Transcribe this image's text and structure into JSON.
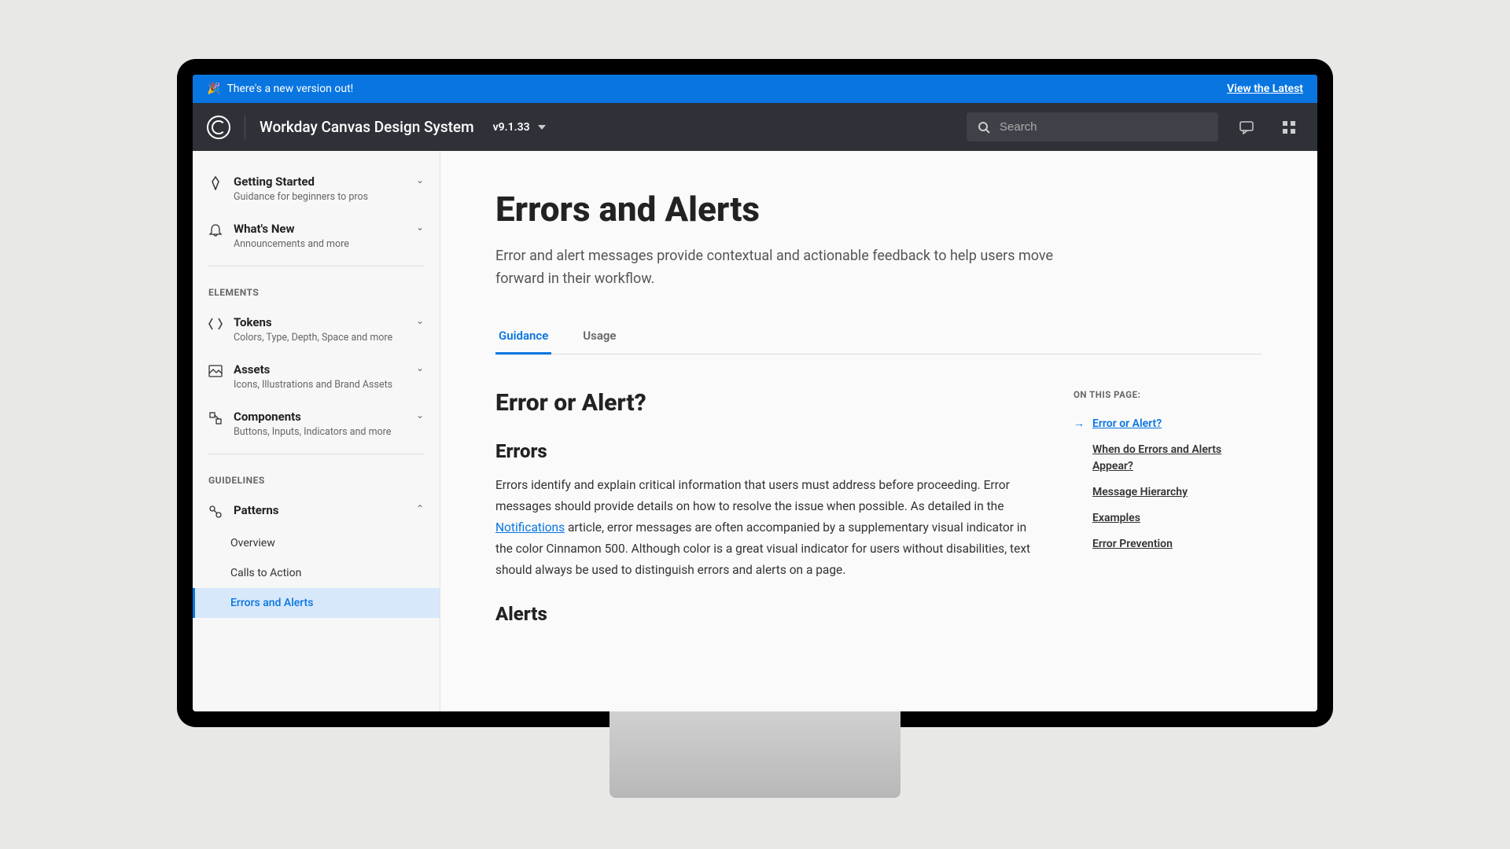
{
  "banner": {
    "emoji": "🎉",
    "text": "There's a new version out!",
    "linkText": "View the Latest"
  },
  "header": {
    "brand": "Workday Canvas Design System",
    "version": "v9.1.33",
    "searchPlaceholder": "Search"
  },
  "sidebar": {
    "items": [
      {
        "title": "Getting Started",
        "desc": "Guidance for beginners to pros"
      },
      {
        "title": "What's New",
        "desc": "Announcements and more"
      }
    ],
    "sectionElements": "ELEMENTS",
    "elements": [
      {
        "title": "Tokens",
        "desc": "Colors, Type, Depth, Space and more"
      },
      {
        "title": "Assets",
        "desc": "Icons, Illustrations and Brand Assets"
      },
      {
        "title": "Components",
        "desc": "Buttons, Inputs, Indicators and more"
      }
    ],
    "sectionGuidelines": "GUIDELINES",
    "patterns": {
      "title": "Patterns"
    },
    "subitems": [
      "Overview",
      "Calls to Action",
      "Errors and Alerts"
    ]
  },
  "page": {
    "title": "Errors and Alerts",
    "desc": "Error and alert messages provide contextual and actionable feedback to help users move forward in their workflow.",
    "tabs": [
      "Guidance",
      "Usage"
    ],
    "h2": "Error or Alert?",
    "h3a": "Errors",
    "para1a": "Errors identify and explain critical information that users must address before proceeding. Error messages should provide details on how to resolve the issue when possible. As detailed in the ",
    "para1link": "Notifications",
    "para1b": " article, error messages are often accompanied by a supplementary visual indicator in the color Cinnamon 500. Although color is a great visual indicator for users without disabilities, text should always be used to distinguish errors and alerts on a page.",
    "h3b": "Alerts"
  },
  "toc": {
    "label": "ON THIS PAGE:",
    "items": [
      "Error or Alert?",
      "When do Errors and Alerts Appear?",
      "Message Hierarchy",
      "Examples",
      "Error Prevention"
    ]
  }
}
